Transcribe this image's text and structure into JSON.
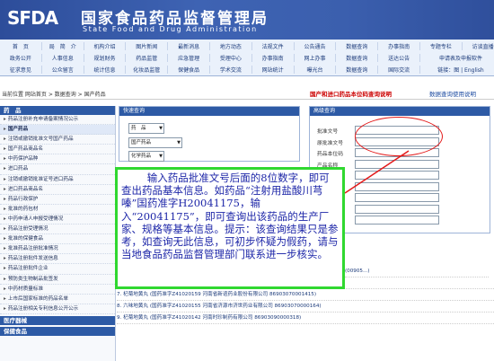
{
  "header": {
    "logo": "SFDA",
    "title": "国家食品药品监督管理局",
    "subtitle": "State Food and Drug Administration"
  },
  "nav": {
    "row1": [
      "首　页",
      "局　简　介",
      "机构介绍",
      "图片新闻",
      "最新消息",
      "地方动态",
      "法规文件",
      "公告通告",
      "数据查询",
      "办事指南",
      "专题专栏",
      "访谈直播",
      "繁体·English"
    ],
    "row2": [
      "政务公开",
      "人事信息",
      "规划财务",
      "药品监管",
      "应急管理",
      "受理中心",
      "办事指南",
      "网上办事",
      "数据查询",
      "送达公告",
      "申请表及申报软件"
    ],
    "row3": [
      "征求意见",
      "公众留言",
      "统计信息",
      "化妆品监管",
      "保健食品",
      "学术交流",
      "网站统计",
      "曝光台",
      "数据查询",
      "国际交流",
      "链接：图 | English"
    ]
  },
  "crumb": {
    "path": "当前位置  网站首页 > 数据查询 > 国产药品",
    "red_link": "国产和进口药品本位码查询说明",
    "blue_link": "数据查询使用说明"
  },
  "sidebar": {
    "head": "药　品",
    "items": [
      "药品注册补充申请备案情况公示",
      "国产药品",
      "注销或撤销批准文号国产药品",
      "国产药品商品名",
      "中药保护品种",
      "进口药品",
      "注销或撤销批准证号进口药品",
      "进口药品商品名",
      "药品行政保护",
      "批准的药包材",
      "中药申请人申报受理情况",
      "药品注册受理情况",
      "批准的保健食品",
      "批准药品注册批准情况",
      "药品注册批件发送信息",
      "药品注册批件企业",
      "预防类生物制品批签发",
      "中药材质量标准",
      "上市后国家标准的药品名单",
      "药品注册相关专利信息公开公示"
    ],
    "head2": "医疗器械",
    "head3": "保健食品"
  },
  "quick": {
    "head": "快速查询",
    "select1": "药　品",
    "select2": "国产药品",
    "select3": "化学药品"
  },
  "advanced": {
    "head": "高级查询",
    "labels": [
      "批准文号",
      "原批准文号",
      "药品本位码",
      "产品名称",
      "英文名称",
      "商品名",
      "剂　型",
      "规　格",
      "生产单位"
    ]
  },
  "results": [
    "(00905...)",
    "6. 杞菊地黄丸  (国药准字Z41020162  河南省济源市济世药业有限公司  86903070001494)",
    "7. 杞菊地黄丸  (国药准字Z41020159  河南省新谊药业股份有限公司  86903070001415)",
    "8. 六味地黄丸  (国药准字Z41020155  河南省济源市济世药业有限公司  86903070000164)",
    "9. 杞菊地黄丸  (国药准字Z41020142  河南时珍制药有限公司  86903090000318)"
  ],
  "annotation": {
    "text": "输入药品批准文号后面的8位数字，即可查出药品基本信息。如药品“注射用盐酸川芎嗪”国药准字H20041175，输入“20041175”，即可查询出该药品的生产厂家、规格等基本信息。提示：该查询结果只是参考，如查询无此信息，可初步怀疑为假药，请与当地食品药品监督管理部门联系进一步核实。",
    "border_color": "#30d830",
    "text_color": "#1d26a8"
  },
  "colors": {
    "header_blue": "#2d4d9a",
    "highlight_red": "#e31a1a"
  }
}
